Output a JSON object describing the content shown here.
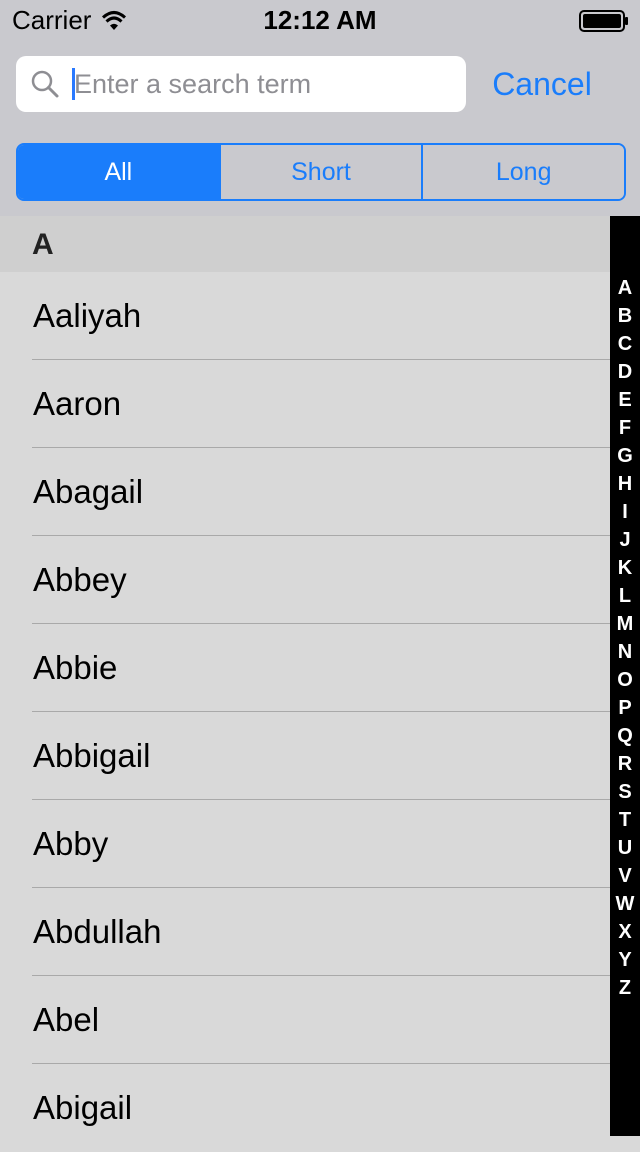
{
  "status_bar": {
    "carrier": "Carrier",
    "time": "12:12 AM"
  },
  "search": {
    "placeholder": "Enter a search term",
    "value": "",
    "cancel_label": "Cancel"
  },
  "scope": {
    "segments": [
      "All",
      "Short",
      "Long"
    ],
    "selected": "All"
  },
  "table": {
    "section_title": "A",
    "rows": [
      "Aaliyah",
      "Aaron",
      "Abagail",
      "Abbey",
      "Abbie",
      "Abbigail",
      "Abby",
      "Abdullah",
      "Abel",
      "Abigail"
    ]
  },
  "index": [
    "A",
    "B",
    "C",
    "D",
    "E",
    "F",
    "G",
    "H",
    "I",
    "J",
    "K",
    "L",
    "M",
    "N",
    "O",
    "P",
    "Q",
    "R",
    "S",
    "T",
    "U",
    "V",
    "W",
    "X",
    "Y",
    "Z"
  ],
  "colors": {
    "accent": "#1a7dfb",
    "bar_background": "#c9c9ce",
    "list_background": "#d9d9d9",
    "index_bar": "#000000"
  }
}
